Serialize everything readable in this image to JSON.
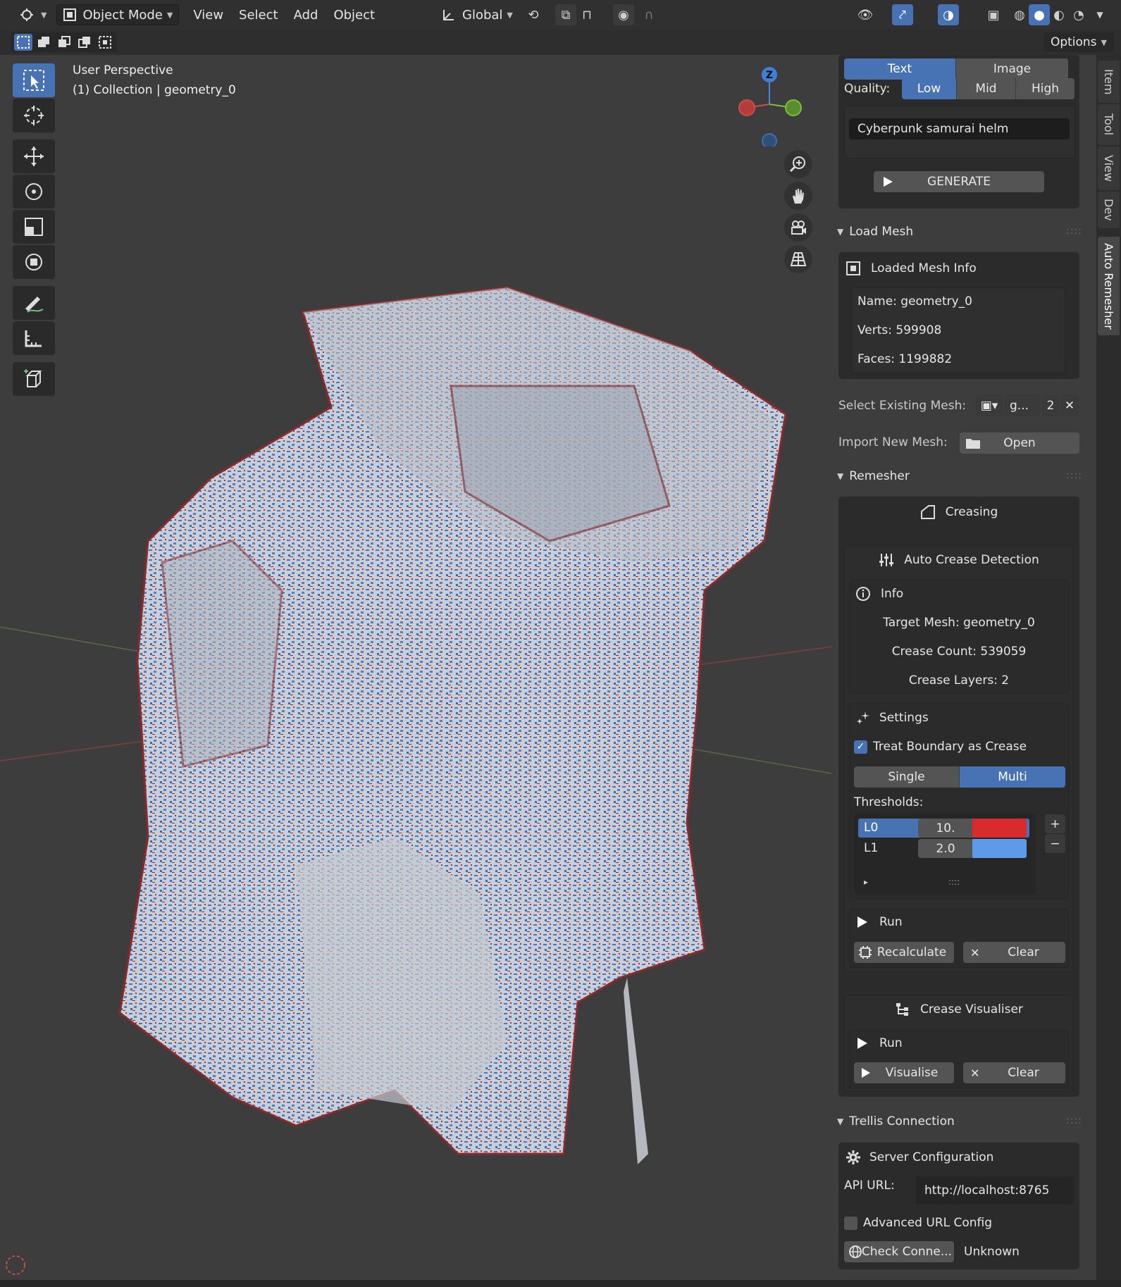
{
  "header": {
    "mode_label": "Object Mode",
    "menus": [
      "View",
      "Select",
      "Add",
      "Object"
    ],
    "transform_orientation": "Global",
    "options_label": "Options"
  },
  "viewport": {
    "perspective_label": "User Perspective",
    "collection_label": "(1) Collection | geometry_0",
    "gizmo_axis_z": "Z"
  },
  "tabs": [
    "Item",
    "Tool",
    "View",
    "Dev",
    "Auto Remesher"
  ],
  "generate": {
    "mode_tabs": [
      "Text",
      "Image"
    ],
    "active_mode": "Text",
    "quality_label": "Quality:",
    "quality_options": [
      "Low",
      "Mid",
      "High"
    ],
    "active_quality": "Low",
    "prompt_value": "Cyberpunk samurai helm",
    "generate_label": "GENERATE"
  },
  "load_mesh": {
    "title": "Load Mesh",
    "info_title": "Loaded Mesh Info",
    "name": "Name: geometry_0",
    "verts": "Verts: 599908",
    "faces": "Faces: 1199882",
    "select_label": "Select Existing Mesh:",
    "select_value": "g...",
    "select_users": "2",
    "import_label": "Import New Mesh:",
    "open_label": "Open"
  },
  "remesher": {
    "title": "Remesher",
    "creasing_label": "Creasing",
    "auto_crease_label": "Auto Crease Detection",
    "info_label": "Info",
    "target_mesh": "Target Mesh: geometry_0",
    "crease_count": "Crease Count: 539059",
    "crease_layers": "Crease Layers: 2",
    "settings_label": "Settings",
    "treat_boundary_label": "Treat Boundary as Crease",
    "treat_boundary_checked": true,
    "layer_modes": [
      "Single",
      "Multi"
    ],
    "active_layer_mode": "Multi",
    "thresholds_label": "Thresholds:",
    "thresholds": [
      {
        "name": "L0",
        "value": "10.",
        "color": "#d92b2b"
      },
      {
        "name": "L1",
        "value": "2.0",
        "color": "#5b9bea"
      }
    ],
    "run_label": "Run",
    "recalculate_label": "Recalculate",
    "clear_label": "Clear",
    "visualiser_label": "Crease Visualiser",
    "vis_run_label": "Run",
    "visualise_label": "Visualise",
    "vis_clear_label": "Clear"
  },
  "trellis": {
    "title": "Trellis Connection",
    "server_config_label": "Server Configuration",
    "api_url_label": "API URL:",
    "api_url_value": "http://localhost:8765",
    "advanced_label": "Advanced URL Config",
    "check_label": "Check Conne...",
    "status": "Unknown"
  },
  "colors": {
    "accent": "#4772b3",
    "crease_red": "#d92b2b",
    "crease_blue": "#5b9bea"
  }
}
